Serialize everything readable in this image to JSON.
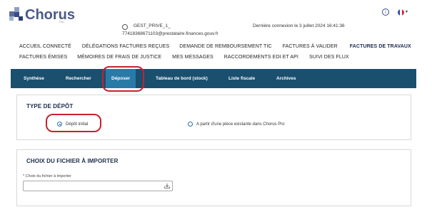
{
  "header": {
    "logo_text": "Chorus",
    "logo_sub": "Pro",
    "user_name": "GEST_PRIVE_1_",
    "user_email": "77418368671103@prestataire.finances.gouv.fr",
    "last_connection": "Dernière connexion le 3 juillet 2024 16:41:36",
    "info_icon_glyph": "i",
    "language_caret": "▾"
  },
  "menu": {
    "row1": [
      "Accueil connecté",
      "Délégations factures reçues",
      "Demande de remboursement TIC",
      "Factures à valider",
      "Factures de travaux"
    ],
    "row2": [
      "Factures émises",
      "Mémoires de frais de justice",
      "Mes messages",
      "Raccordements EDI et API",
      "Suivi des flux"
    ],
    "active": "Factures de travaux"
  },
  "subnav": {
    "items": [
      "Synthèse",
      "Rechercher",
      "Déposer",
      "Tableau de bord (stock)",
      "Liste fiscale",
      "Archives"
    ],
    "active": "Déposer"
  },
  "deposit_type": {
    "title": "Type de dépôt",
    "options": [
      {
        "label": "Dépôt initial",
        "selected": true
      },
      {
        "label": "A partir d'une pièce existante dans Chorus Pro",
        "selected": false
      }
    ]
  },
  "file_import": {
    "title": "Choix du fichier à importer",
    "field_label": "* Choix du fichier à importer",
    "field_value": ""
  },
  "colors": {
    "subnav_bg": "#1a4f6e",
    "subnav_active": "#2a7aa8",
    "highlight": "#c8222e",
    "logo": "#4a5a88"
  },
  "icons": [
    "chorus-logo-icon",
    "info-icon",
    "flag-fr-icon",
    "user-icon",
    "upload-icon"
  ]
}
